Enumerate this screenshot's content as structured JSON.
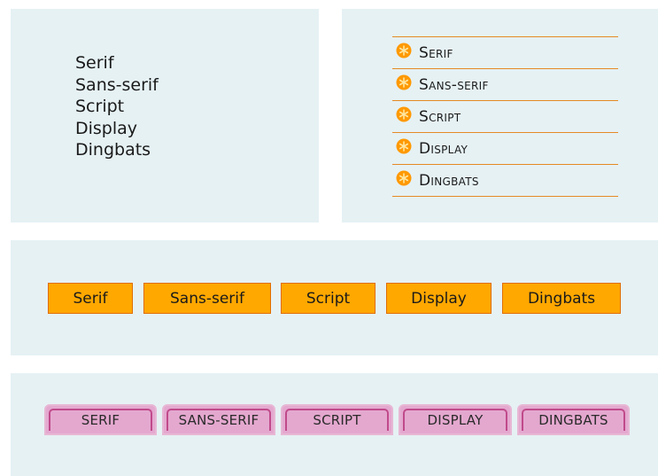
{
  "panels": {
    "plain": {
      "items": [
        "Serif",
        "Sans-serif",
        "Script",
        "Display",
        "Dingbats"
      ]
    },
    "bullet": {
      "items": [
        "Serif",
        "Sans-serif",
        "Script",
        "Display",
        "Dingbats"
      ],
      "icon": "orange-asterisk-icon",
      "bullet_color": "#ff9900",
      "rule_color": "#e58a24"
    },
    "orange": {
      "items": [
        "Serif",
        "Sans-serif",
        "Script",
        "Display",
        "Dingbats"
      ],
      "fill_color": "#ffa800",
      "border_color": "#e06d00"
    },
    "pink": {
      "items": [
        "SERIF",
        "SANS-SERIF",
        "SCRIPT",
        "DISPLAY",
        "DINGBATS"
      ],
      "fill_color": "#e4a8cf",
      "border_color": "#c04a8b"
    }
  },
  "background_color": "#e6f1f4"
}
